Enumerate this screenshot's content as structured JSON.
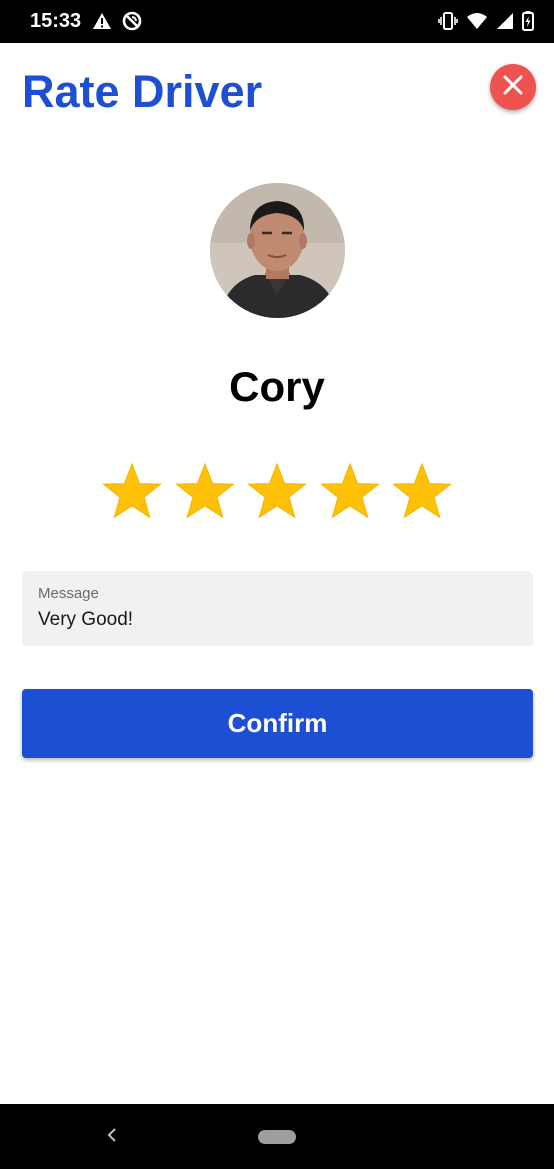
{
  "status_bar": {
    "time": "15:33",
    "left_icons": [
      "warning-icon",
      "no-sync-icon"
    ],
    "right_icons": [
      "vibrate-icon",
      "wifi-icon",
      "signal-icon",
      "battery-charging-icon"
    ]
  },
  "header": {
    "title": "Rate Driver",
    "close_icon": "close-icon",
    "title_color": "#1e4fd0",
    "close_color": "#ef5350"
  },
  "driver": {
    "name": "Cory"
  },
  "rating": {
    "value": 5,
    "max": 5,
    "star_color": "#ffc107"
  },
  "message": {
    "label": "Message",
    "value": "Very Good!"
  },
  "actions": {
    "confirm_label": "Confirm",
    "confirm_color": "#1c4fd1"
  },
  "nav_bar": {
    "icons": [
      "back-icon",
      "home-pill-icon"
    ]
  }
}
